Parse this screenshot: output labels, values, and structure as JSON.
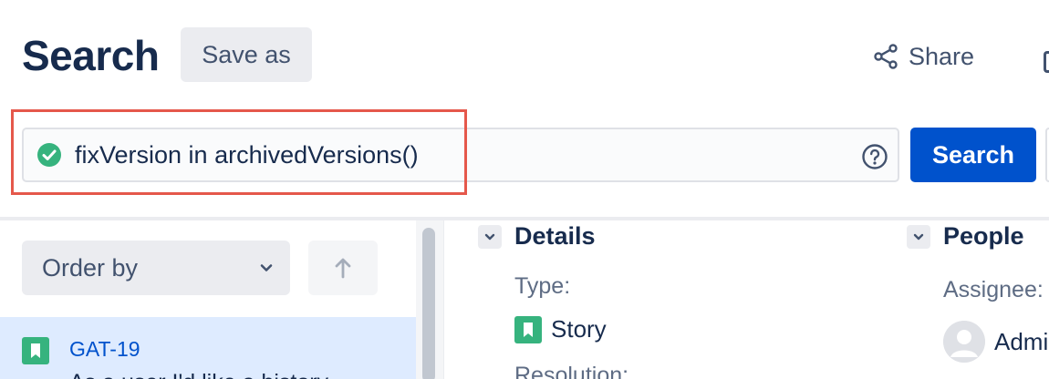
{
  "header": {
    "title": "Search",
    "save_as_label": "Save as",
    "share_label": "Share"
  },
  "search_bar": {
    "query": "fixVersion in archivedVersions()",
    "search_label": "Search",
    "valid_icon": "check-circle-icon",
    "help_icon": "question-circle-icon"
  },
  "list_controls": {
    "order_by_label": "Order by",
    "sort_icon": "arrow-up-icon"
  },
  "issues": [
    {
      "key": "GAT-19",
      "summary": "As a user I'd like a history",
      "type_icon": "story-icon"
    }
  ],
  "details": {
    "section_title": "Details",
    "type_label": "Type:",
    "type_value": "Story",
    "resolution_label": "Resolution:"
  },
  "people": {
    "section_title": "People",
    "assignee_label": "Assignee:",
    "assignee_value": "Admin"
  },
  "colors": {
    "primary": "#0052cc",
    "highlight_border": "#e5584b",
    "valid": "#36b37e",
    "story": "#36b37e",
    "selected_row": "#deebff"
  }
}
